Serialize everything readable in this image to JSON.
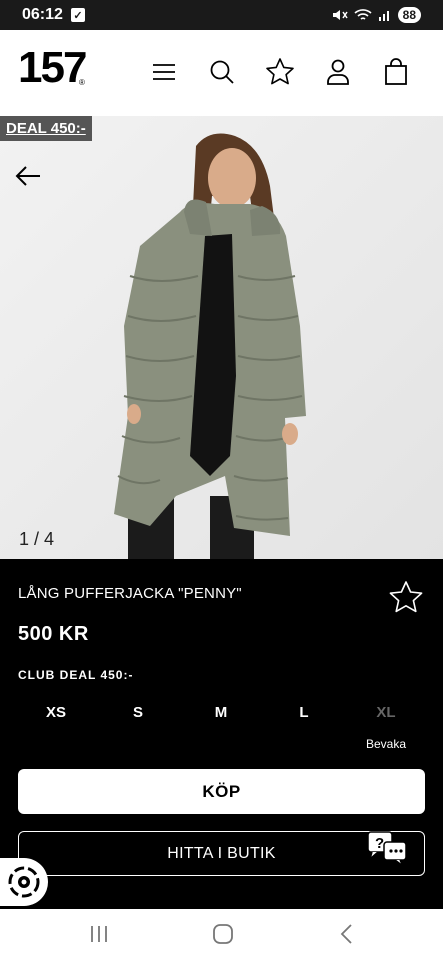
{
  "status": {
    "time": "06:12",
    "battery": "88",
    "icons": [
      "mute-icon",
      "wifi-icon",
      "signal-icon"
    ]
  },
  "header": {
    "logo": "157",
    "icons": [
      "menu-icon",
      "search-icon",
      "star-icon",
      "user-icon",
      "bag-icon"
    ]
  },
  "hero": {
    "deal_badge": "DEAL 450:-",
    "pager": "1 / 4"
  },
  "product": {
    "name": "LÅNG PUFFERJACKA \"PENNY\"",
    "price": "500 KR",
    "club_deal": "CLUB DEAL 450:-",
    "sizes": [
      {
        "label": "XS",
        "available": true
      },
      {
        "label": "S",
        "available": true
      },
      {
        "label": "M",
        "available": true
      },
      {
        "label": "L",
        "available": true
      },
      {
        "label": "XL",
        "available": false
      }
    ],
    "watch_label": "Bevaka",
    "buy_label": "KÖP",
    "find_in_store_label": "HITTA I BUTIK"
  },
  "colors": {
    "coat": "#8a907e",
    "background": "#000000",
    "badge": "#555555"
  }
}
